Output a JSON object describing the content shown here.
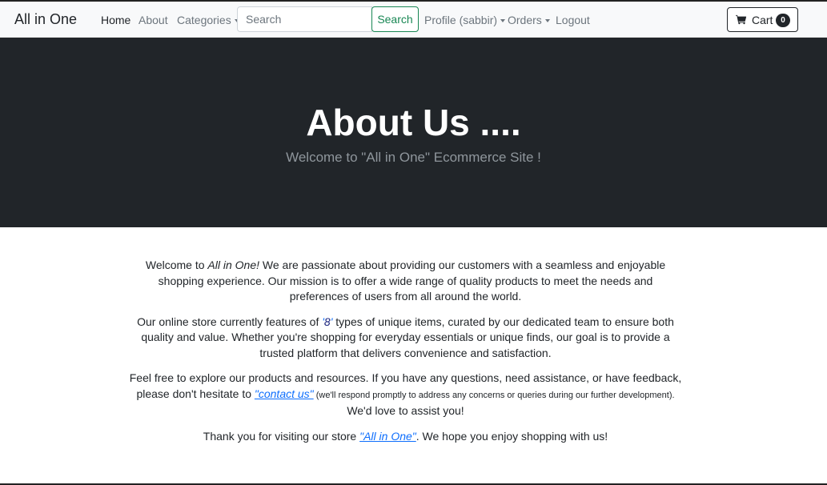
{
  "navbar": {
    "brand": "All in One",
    "home": "Home",
    "about": "About",
    "categories": "Categories",
    "search_placeholder": "Search",
    "search_button": "Search",
    "profile": "Profile (sabbir)",
    "orders": "Orders",
    "logout": "Logout",
    "cart_label": "Cart",
    "cart_count": "0",
    "cart_icon": "shopping-cart-icon"
  },
  "hero": {
    "title": "About Us ....",
    "subtitle": "Welcome to \"All in One\" Ecommerce Site !"
  },
  "content": {
    "p1_prefix": "Welcome to ",
    "p1_store": "All in One!",
    "p1_rest": " We are passionate about providing our customers with a seamless and enjoyable shopping experience. Our mission is to offer a wide range of quality products to meet the needs and preferences of users from all around the world.",
    "p2_prefix": "Our online store currently features of ",
    "p2_quote_open": "'",
    "p2_count": "8",
    "p2_quote_close": "'",
    "p2_rest": " types of unique items, curated by our dedicated team to ensure both quality and value. Whether you're shopping for everyday essentials or unique finds, our goal is to provide a trusted platform that delivers convenience and satisfaction.",
    "p3_prefix": "Feel free to explore our products and resources. If you have any questions, need assistance, or have feedback, please don't hesitate to ",
    "p3_link": "\"contact us\"",
    "p3_small": " (we'll respond promptly to address any concerns or queries during our further development).",
    "p3_rest": " We'd love to assist you!",
    "p4_prefix": "Thank you for visiting our store ",
    "p4_link": "\"All in One\"",
    "p4_rest": ". We hope you enjoy shopping with us!"
  }
}
